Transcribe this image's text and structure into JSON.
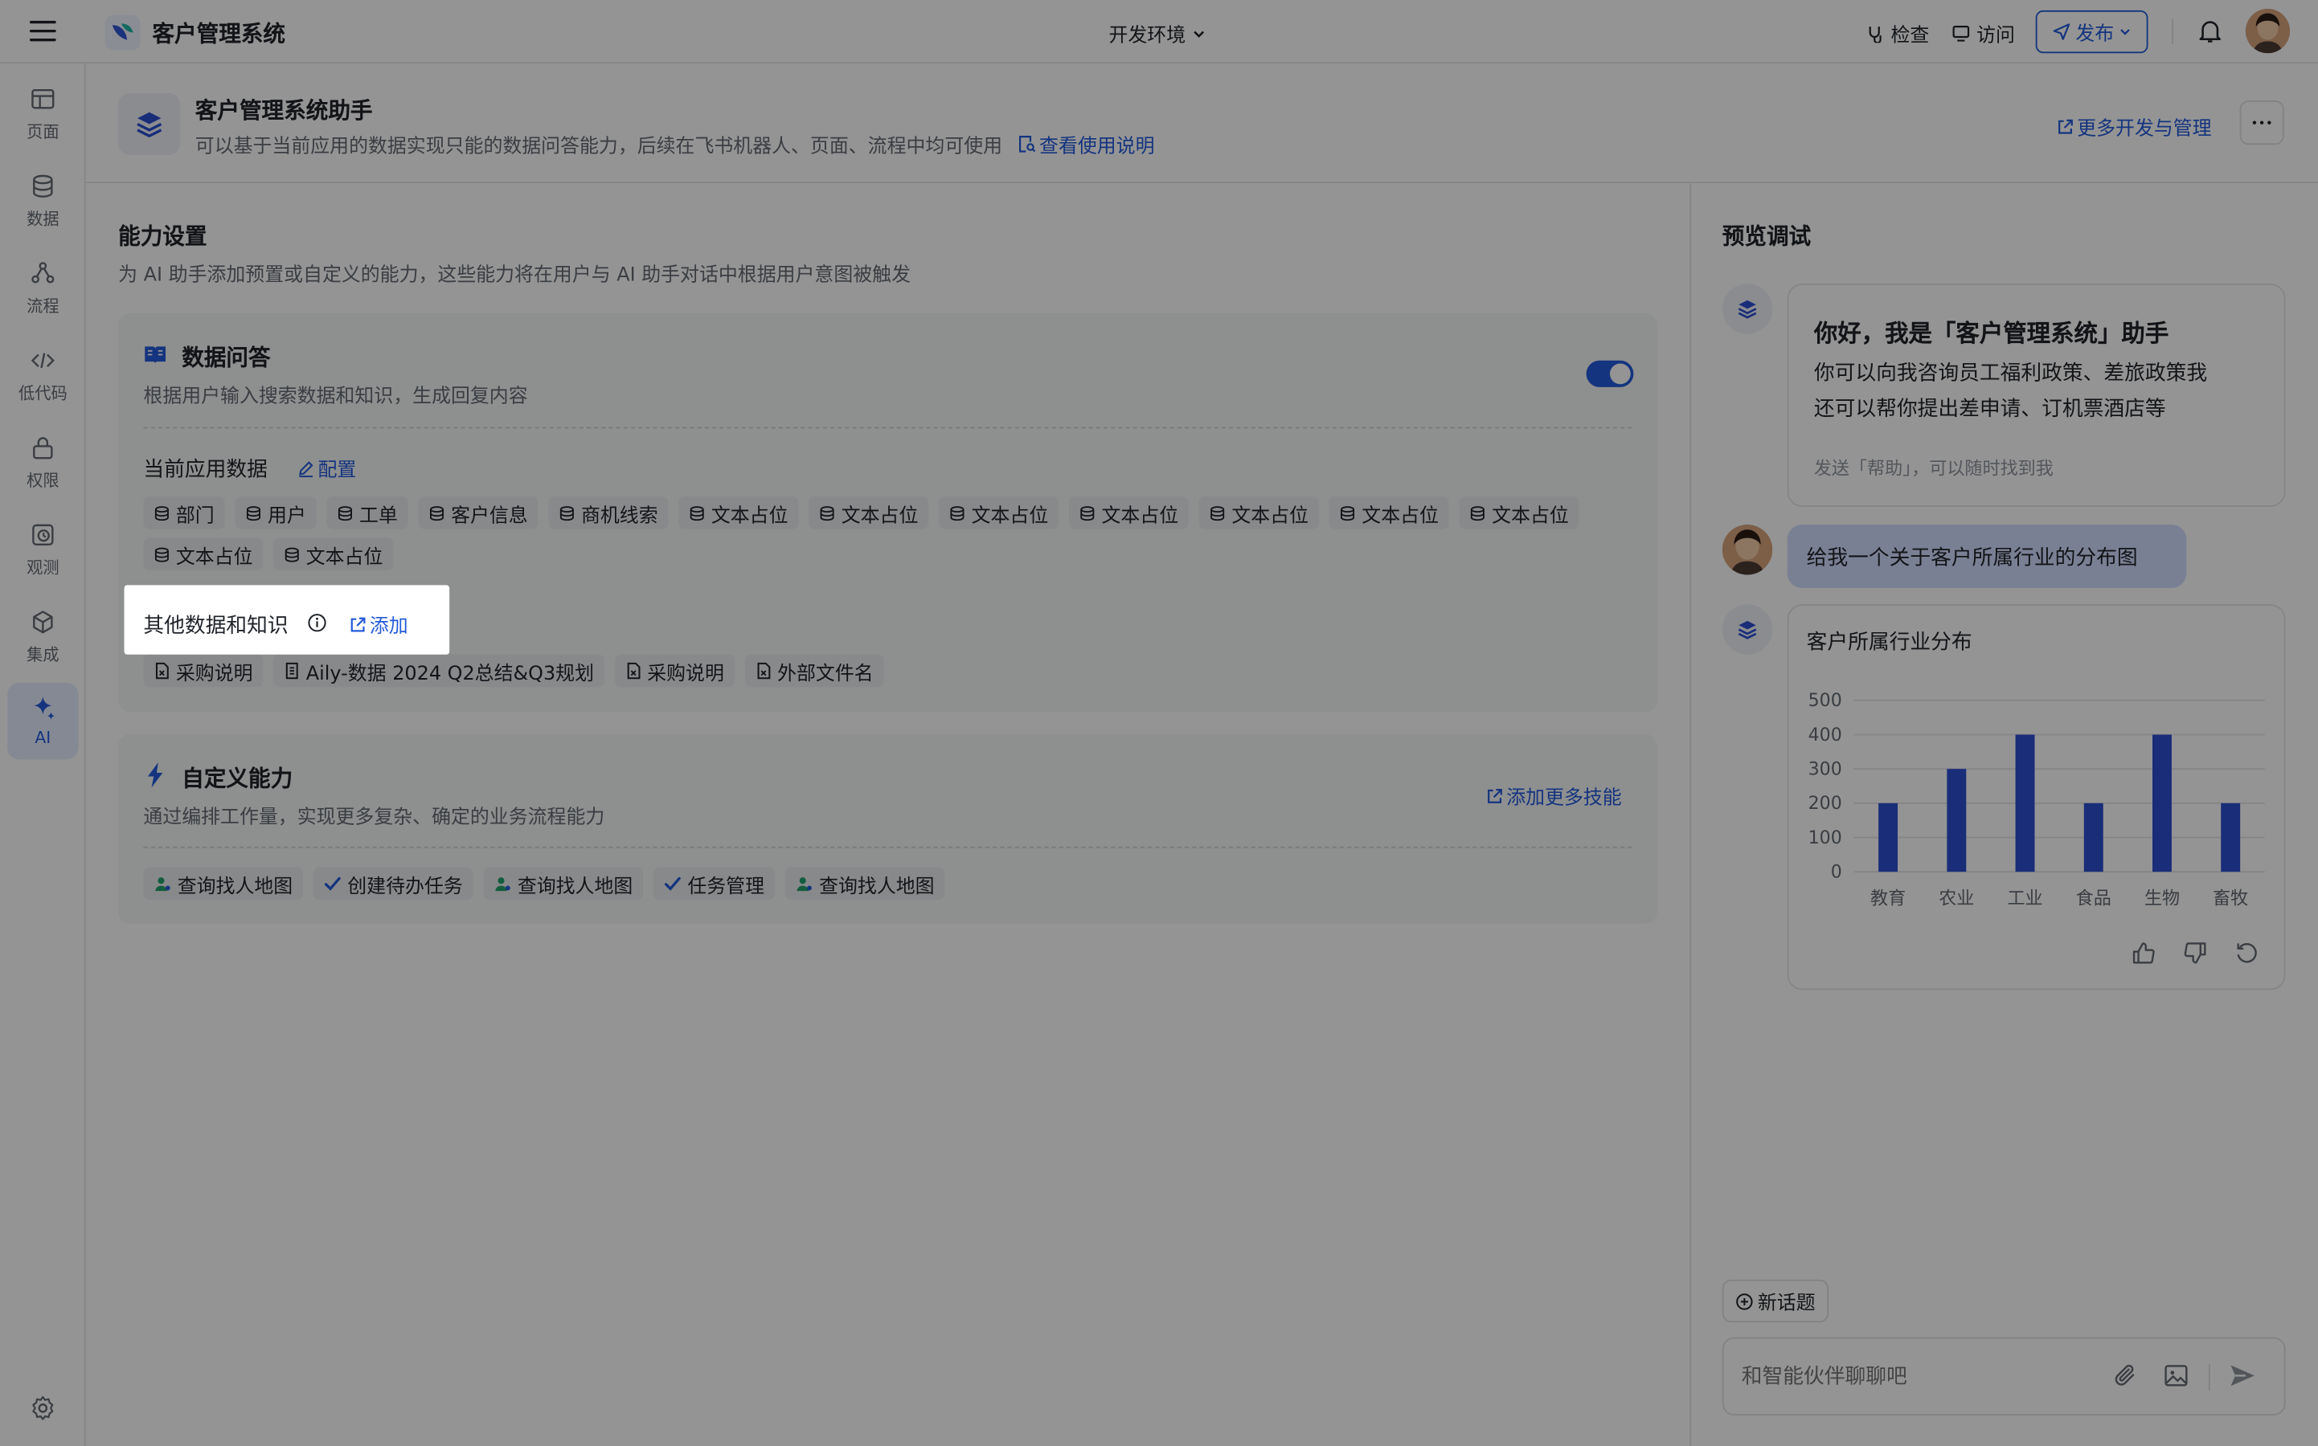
{
  "topbar": {
    "app_name": "客户管理系统",
    "env_label": "开发环境",
    "check_label": "检查",
    "visit_label": "访问",
    "publish_label": "发布"
  },
  "sidebar": {
    "items": [
      {
        "label": "页面",
        "icon": "page-icon"
      },
      {
        "label": "数据",
        "icon": "database-icon"
      },
      {
        "label": "流程",
        "icon": "flow-icon"
      },
      {
        "label": "低代码",
        "icon": "code-icon"
      },
      {
        "label": "权限",
        "icon": "lock-icon"
      },
      {
        "label": "观测",
        "icon": "observe-icon"
      },
      {
        "label": "集成",
        "icon": "integration-icon"
      },
      {
        "label": "AI",
        "icon": "ai-sparkle-icon",
        "active": true
      }
    ]
  },
  "header": {
    "title": "客户管理系统助手",
    "description": "可以基于当前应用的数据实现只能的数据问答能力，后续在飞书机器人、页面、流程中均可使用",
    "doc_link": "查看使用说明",
    "more_link": "更多开发与管理"
  },
  "capability": {
    "title": "能力设置",
    "description": "为 AI 助手添加预置或自定义的能力，这些能力将在用户与 AI 助手对话中根据用户意图被触发"
  },
  "data_qa": {
    "title": "数据问答",
    "description": "根据用户输入搜索数据和知识，生成回复内容",
    "enabled": true,
    "current_data_label": "当前应用数据",
    "config_link": "配置",
    "tables_row1": [
      "部门",
      "用户",
      "工单",
      "客户信息",
      "商机线索",
      "文本占位",
      "文本占位",
      "文本占位",
      "文本占位",
      "文本占位",
      "文本占位",
      "文本占位"
    ],
    "tables_row2": [
      "文本占位",
      "文本占位"
    ],
    "other_label": "其他数据和知识",
    "add_link": "添加",
    "docs": [
      "采购说明",
      "Aily-数据 2024 Q2总结&Q3规划",
      "采购说明",
      "外部文件名"
    ]
  },
  "custom": {
    "title": "自定义能力",
    "description": "通过编排工作量，实现更多复杂、确定的业务流程能力",
    "add_link": "添加更多技能",
    "skills": [
      "查询找人地图",
      "创建待办任务",
      "查询找人地图",
      "任务管理",
      "查询找人地图"
    ]
  },
  "preview": {
    "title": "预览调试",
    "greeting_title": "你好，我是「客户管理系统」助手",
    "greeting_line1": "你可以向我咨询员工福利政策、差旅政策我",
    "greeting_line2": "还可以帮你提出差申请、订机票酒店等",
    "greeting_hint": "发送「帮助」，可以随时找到我",
    "user_message": "给我一个关于客户所属行业的分布图",
    "new_topic": "新话题",
    "input_placeholder": "和智能伙伴聊聊吧"
  },
  "chart_data": {
    "type": "bar",
    "title": "客户所属行业分布",
    "categories": [
      "教育",
      "农业",
      "工业",
      "食品",
      "生物",
      "畜牧"
    ],
    "values": [
      200,
      300,
      400,
      200,
      400,
      200
    ],
    "ylim": [
      0,
      500
    ],
    "yticks": [
      0,
      100,
      200,
      300,
      400,
      500
    ],
    "color": "#2b4fd1",
    "grid": true
  },
  "colors": {
    "accent": "#245bdb",
    "overlay": "rgba(0,0,0,0.42)"
  }
}
